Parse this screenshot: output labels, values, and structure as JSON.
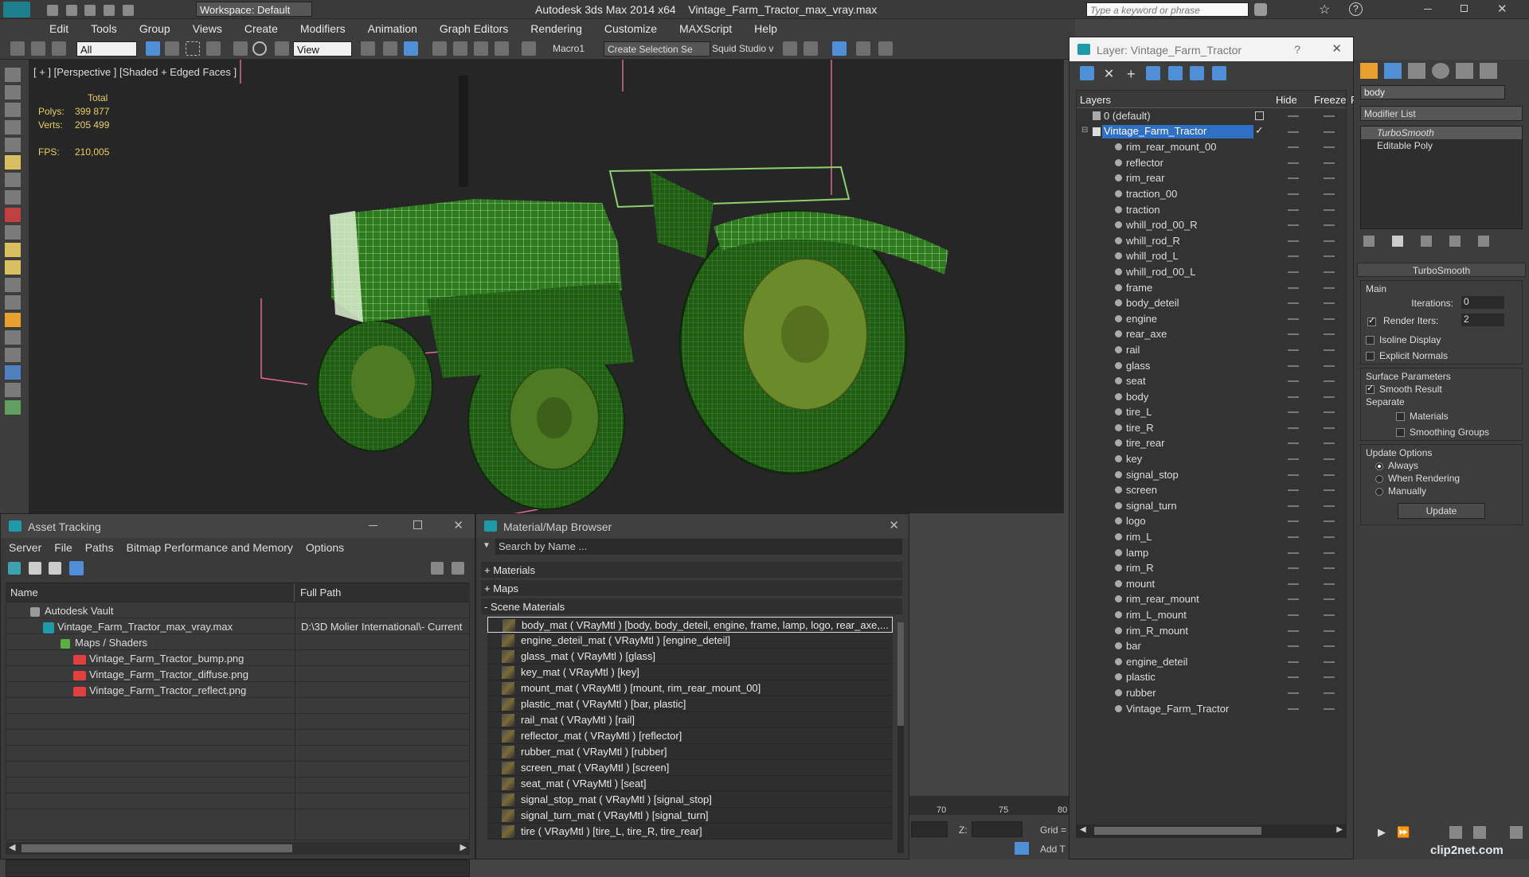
{
  "app": {
    "title": "Autodesk 3ds Max  2014 x64",
    "file": "Vintage_Farm_Tractor_max_vray.max",
    "workspace": "Workspace: Default",
    "search_placeholder": "Type a keyword or phrase"
  },
  "menu": [
    "Edit",
    "Tools",
    "Group",
    "Views",
    "Create",
    "Modifiers",
    "Animation",
    "Graph Editors",
    "Rendering",
    "Customize",
    "MAXScript",
    "Help"
  ],
  "toolbar": {
    "filter": "All",
    "ref_coord": "View",
    "macro": "Macro1",
    "selection_set": "Create Selection Se",
    "squid": "Squid Studio v"
  },
  "viewport": {
    "label": "[ + ] [Perspective ] [Shaded + Edged Faces ]",
    "stats_header": "Total",
    "polys_label": "Polys:",
    "polys_value": "399 877",
    "verts_label": "Verts:",
    "verts_value": "205 499",
    "fps_label": "FPS:",
    "fps_value": "210,005"
  },
  "asset_tracking": {
    "title": "Asset Tracking",
    "menu": [
      "Server",
      "File",
      "Paths",
      "Bitmap Performance and Memory",
      "Options"
    ],
    "col_name": "Name",
    "col_path": "Full Path",
    "rows": [
      {
        "name": "Autodesk Vault",
        "path": ""
      },
      {
        "name": "Vintage_Farm_Tractor_max_vray.max",
        "path": "D:\\3D Molier International\\- Current"
      },
      {
        "name": "Maps / Shaders",
        "path": ""
      },
      {
        "name": "Vintage_Farm_Tractor_bump.png",
        "path": ""
      },
      {
        "name": "Vintage_Farm_Tractor_diffuse.png",
        "path": ""
      },
      {
        "name": "Vintage_Farm_Tractor_reflect.png",
        "path": ""
      }
    ]
  },
  "material_browser": {
    "title": "Material/Map Browser",
    "search_placeholder": "Search by Name ...",
    "sections": [
      "+ Materials",
      "+ Maps",
      "- Scene Materials"
    ],
    "materials": [
      "body_mat  ( VRayMtl ) [body, body_deteil, engine, frame, lamp, logo, rear_axe,...",
      "engine_deteil_mat  ( VRayMtl ) [engine_deteil]",
      "glass_mat  ( VRayMtl ) [glass]",
      "key_mat  ( VRayMtl ) [key]",
      "mount_mat  ( VRayMtl ) [mount, rim_rear_mount_00]",
      "plastic_mat  ( VRayMtl ) [bar, plastic]",
      "rail_mat  ( VRayMtl ) [rail]",
      "reflector_mat  ( VRayMtl ) [reflector]",
      "rubber_mat  ( VRayMtl ) [rubber]",
      "screen_mat  ( VRayMtl ) [screen]",
      "seat_mat  ( VRayMtl ) [seat]",
      "signal_stop_mat  ( VRayMtl ) [signal_stop]",
      "signal_turn_mat  ( VRayMtl ) [signal_turn]",
      "tire  ( VRayMtl ) [tire_L, tire_R, tire_rear]"
    ]
  },
  "layer_window": {
    "title": "Layer: Vintage_Farm_Tractor",
    "help": "?",
    "col_layers": "Layers",
    "col_hide": "Hide",
    "col_freeze": "Freeze",
    "col_r": "R",
    "default_layer": "0 (default)",
    "active_layer": "Vintage_Farm_Tractor",
    "objects": [
      "rim_rear_mount_00",
      "reflector",
      "rim_rear",
      "traction_00",
      "traction",
      "whill_rod_00_R",
      "whill_rod_R",
      "whill_rod_L",
      "whill_rod_00_L",
      "frame",
      "body_deteil",
      "engine",
      "rear_axe",
      "rail",
      "glass",
      "seat",
      "body",
      "tire_L",
      "tire_R",
      "tire_rear",
      "key",
      "signal_stop",
      "screen",
      "signal_turn",
      "logo",
      "rim_L",
      "lamp",
      "rim_R",
      "mount",
      "rim_rear_mount",
      "rim_L_mount",
      "rim_R_mount",
      "bar",
      "engine_deteil",
      "plastic",
      "rubber",
      "Vintage_Farm_Tractor"
    ]
  },
  "command_panel": {
    "object_name": "body",
    "modifier_list": "Modifier List",
    "stack": [
      "TurboSmooth",
      "Editable Poly"
    ],
    "rollout_title": "TurboSmooth",
    "main_label": "Main",
    "iterations_label": "Iterations:",
    "iterations_value": "0",
    "render_iters_label": "Render Iters:",
    "render_iters_value": "2",
    "isoline": "Isoline Display",
    "explicit": "Explicit Normals",
    "surface_params": "Surface Parameters",
    "smooth_result": "Smooth Result",
    "separate": "Separate",
    "materials": "Materials",
    "smoothing_groups": "Smoothing Groups",
    "update_options": "Update Options",
    "always": "Always",
    "when_rendering": "When Rendering",
    "manually": "Manually",
    "update_button": "Update"
  },
  "timeline": {
    "ticks": [
      "70",
      "75",
      "80"
    ],
    "z_label": "Z:",
    "grid_label": "Grid =",
    "add_label": "Add T"
  },
  "watermark": "clip2net.com"
}
